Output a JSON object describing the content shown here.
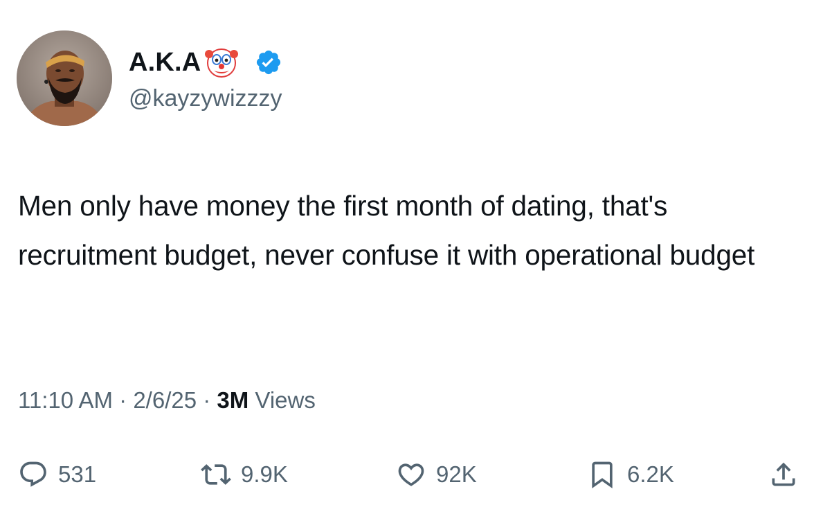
{
  "user": {
    "display_name": "A.K.A",
    "handle": "@kayzywizzzy",
    "avatar_icon": "profile-photo",
    "name_emoji": "clown-face-icon",
    "verified_icon": "verified-badge-icon",
    "verified_color": "#1d9bf0"
  },
  "tweet": {
    "text": "Men only have money the first month of dating, that's recruitment budget, never confuse it with operational budget"
  },
  "meta": {
    "time": "11:10 AM",
    "separator": "·",
    "date": "2/6/25",
    "views_count": "3M",
    "views_label": " Views"
  },
  "actions": {
    "reply": {
      "icon": "reply-icon",
      "count": "531"
    },
    "retweet": {
      "icon": "retweet-icon",
      "count": "9.9K"
    },
    "like": {
      "icon": "heart-icon",
      "count": "92K"
    },
    "bookmark": {
      "icon": "bookmark-icon",
      "count": "6.2K"
    },
    "share": {
      "icon": "share-icon"
    }
  },
  "colors": {
    "text_primary": "#0f1419",
    "text_secondary": "#536471",
    "accent": "#1d9bf0"
  }
}
